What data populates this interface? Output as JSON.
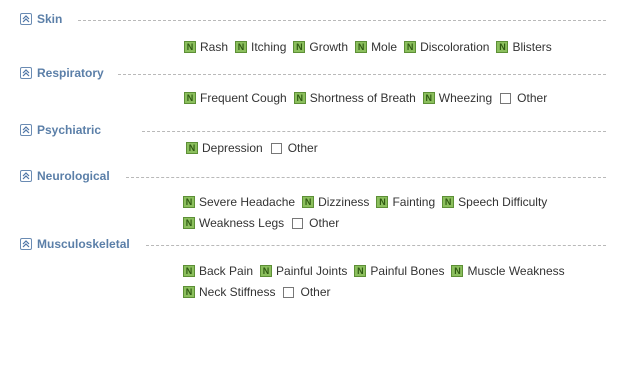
{
  "sections": [
    {
      "title": "Skin",
      "options": [
        "Rash",
        "Itching",
        "Growth",
        "Mole",
        "Discoloration",
        "Blisters"
      ],
      "other_label": ""
    },
    {
      "title": "Respiratory",
      "options": [
        "Frequent Cough",
        "Shortness of Breath",
        "Wheezing"
      ],
      "other_label": "Other"
    },
    {
      "title": "Psychiatric",
      "options": [
        "Depression"
      ],
      "other_label": "Other"
    },
    {
      "title": "Neurological",
      "options_row1": [
        "Severe Headache",
        "Dizziness",
        "Fainting",
        "Speech Difficulty"
      ],
      "options_row2": [
        "Weakness Legs"
      ],
      "other_label": "Other"
    },
    {
      "title": "Musculoskeletal",
      "options_row1": [
        "Back Pain",
        "Painful Joints",
        "Painful Bones",
        "Muscle Weakness"
      ],
      "options_row2": [
        "Neck Stiffness"
      ],
      "other_label": "Other"
    }
  ],
  "no_marker": "N",
  "colors": {
    "header_text": "#5b7fa8",
    "n_box": "#8bbf5d"
  }
}
